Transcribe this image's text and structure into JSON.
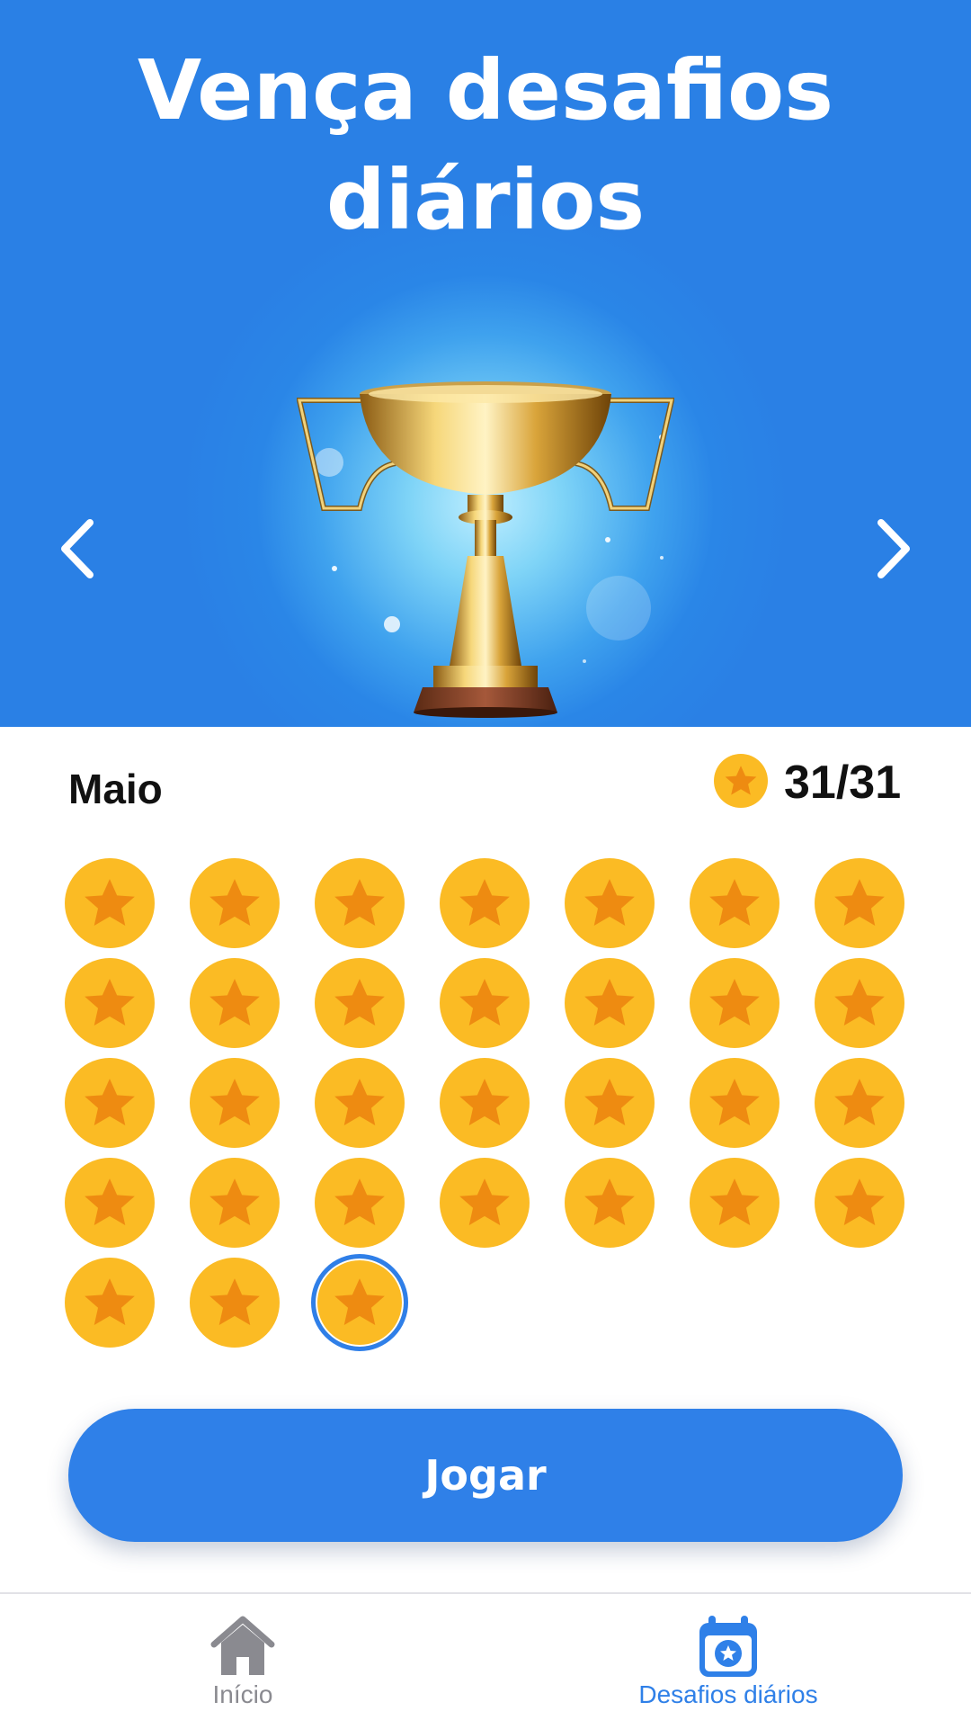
{
  "hero": {
    "title_line1": "Vença desafios",
    "title_line2": "diários",
    "prev_icon": "chevron-left-icon",
    "next_icon": "chevron-right-icon",
    "image": "trophy"
  },
  "summary": {
    "month": "Maio",
    "completed": "31/31",
    "coin_icon": "star-coin-icon"
  },
  "calendar": {
    "days_completed": 31,
    "total_days": 31,
    "selected_day": 31,
    "coin_color": "#fbbb24",
    "star_color": "#ee8b11"
  },
  "play_button": {
    "label": "Jogar"
  },
  "tabbar": {
    "home_label": "Início",
    "challenges_label": "Desafios diários",
    "active_tab": "challenges"
  },
  "colors": {
    "accent": "#2f80e8",
    "hero_background": "#2a80e5",
    "inactive_tab": "#8a8a90"
  }
}
